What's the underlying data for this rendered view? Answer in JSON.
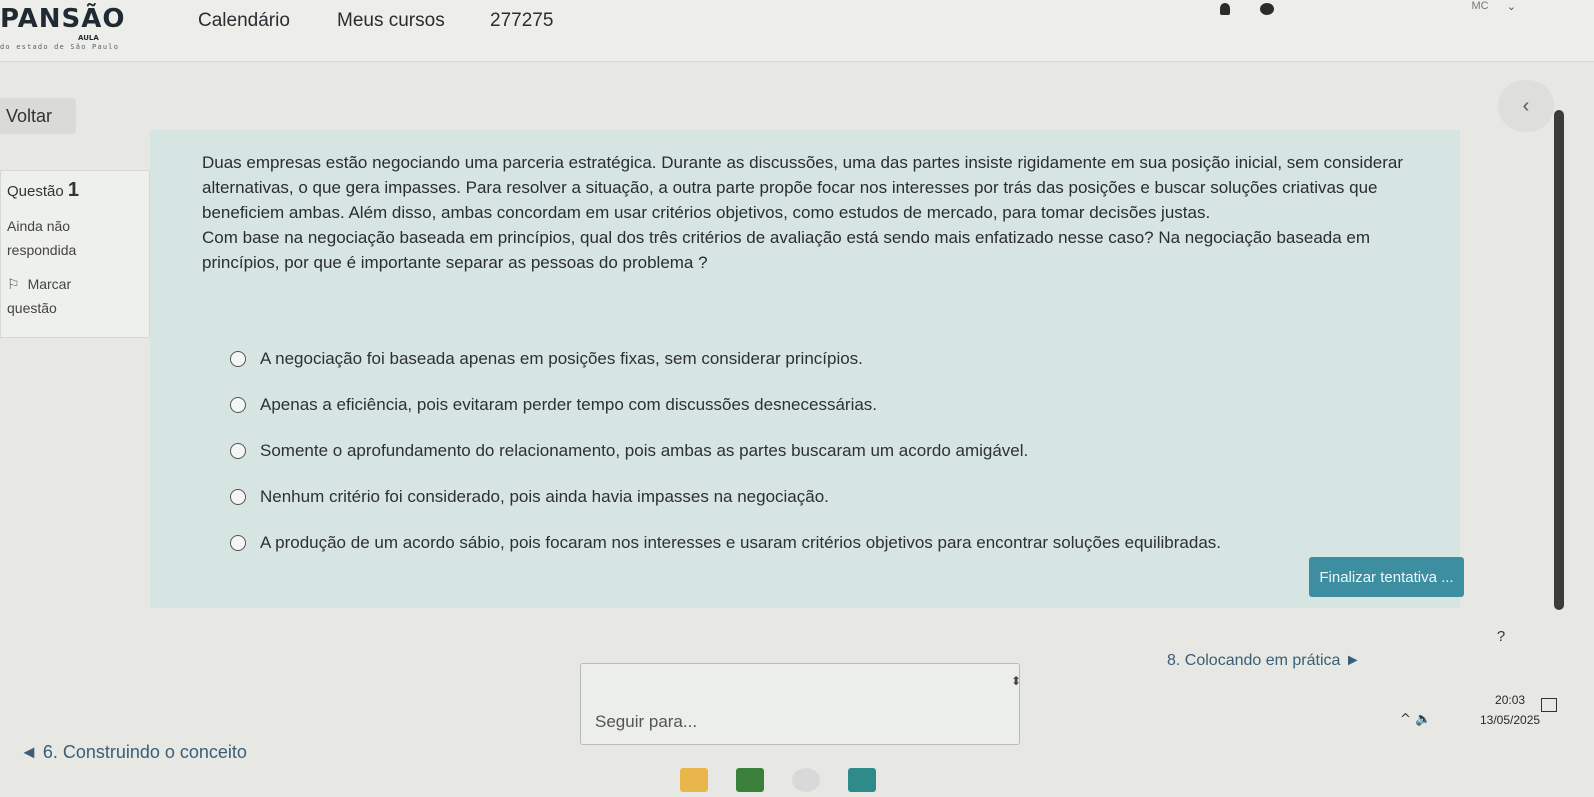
{
  "brand": {
    "logo": "PANSÃO",
    "aula": "AULA",
    "subtitle": "do estado de São Paulo"
  },
  "nav": {
    "items": [
      "Calendário",
      "Meus cursos",
      "277275"
    ],
    "user_initials": "MC"
  },
  "voltar_label": "Voltar",
  "question": {
    "label": "Questão",
    "number": "1",
    "status_line1": "Ainda não",
    "status_line2": "respondida",
    "flag_line1": "Marcar",
    "flag_line2": "questão",
    "text_lines": [
      "Duas empresas estão negociando uma parceria estratégica. Durante as discussões, uma das partes insiste rigidamente em sua posição inicial, sem considerar",
      "alternativas, o que gera impasses. Para resolver a situação, a outra parte propõe focar nos interesses por trás das posições e buscar soluções criativas que",
      "beneficiem ambas. Além disso, ambas concordam em usar critérios objetivos, como estudos de mercado, para tomar decisões justas.",
      "Com base na negociação baseada em princípios, qual dos três critérios de avaliação está sendo mais enfatizado nesse caso? Na negociação baseada em",
      "princípios, por que é importante separar as pessoas do problema ?"
    ],
    "answers": [
      "A negociação foi baseada apenas em posições fixas, sem considerar princípios.",
      "Apenas a eficiência, pois evitaram perder tempo com discussões desnecessárias.",
      "Somente o aprofundamento do relacionamento, pois ambas as partes buscaram um acordo amigável.",
      "Nenhum critério foi considerado, pois ainda havia impasses na negociação.",
      "A produção de um acordo sábio, pois focaram nos interesses e usaram critérios objetivos para encontrar soluções equilibradas."
    ]
  },
  "finalize_label": "Finalizar tentativa ...",
  "bottom_nav": {
    "prev": "◄ 6. Construindo o conceito",
    "jump_placeholder": "Seguir para...",
    "next": "8. Colocando em prática ►",
    "help": "?"
  },
  "tray": {
    "time": "20:03",
    "date": "13/05/2025"
  }
}
